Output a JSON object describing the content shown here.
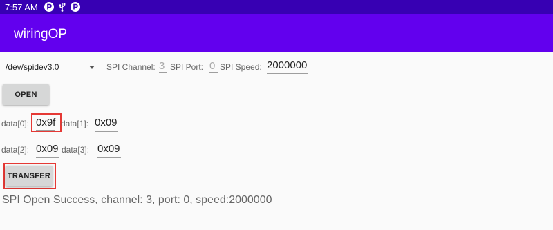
{
  "status_bar": {
    "time": "7:57 AM",
    "icons": [
      "p-circle-icon",
      "usb-icon",
      "p-circle-icon"
    ]
  },
  "app_bar": {
    "title": "wiringOP"
  },
  "spi": {
    "device": "/dev/spidev3.0",
    "channel_label": "SPI Channel:",
    "channel_value": "3",
    "port_label": "SPI Port:",
    "port_value": "0",
    "speed_label": "SPI Speed:",
    "speed_value": "2000000"
  },
  "buttons": {
    "open": "OPEN",
    "transfer": "TRANSFER"
  },
  "data_fields": [
    {
      "label": "data[0]:",
      "value": "0x9f"
    },
    {
      "label": "data[1]:",
      "value": "0x09"
    },
    {
      "label": "data[2]:",
      "value": "0x09"
    },
    {
      "label": "data[3]:",
      "value": "0x09"
    }
  ],
  "status_message": "SPI Open Success, channel: 3, port: 0, speed:2000000",
  "colors": {
    "status_bar": "#3700b3",
    "app_bar": "#6200ee",
    "highlight": "#e53935",
    "button": "#d6d7d7"
  }
}
